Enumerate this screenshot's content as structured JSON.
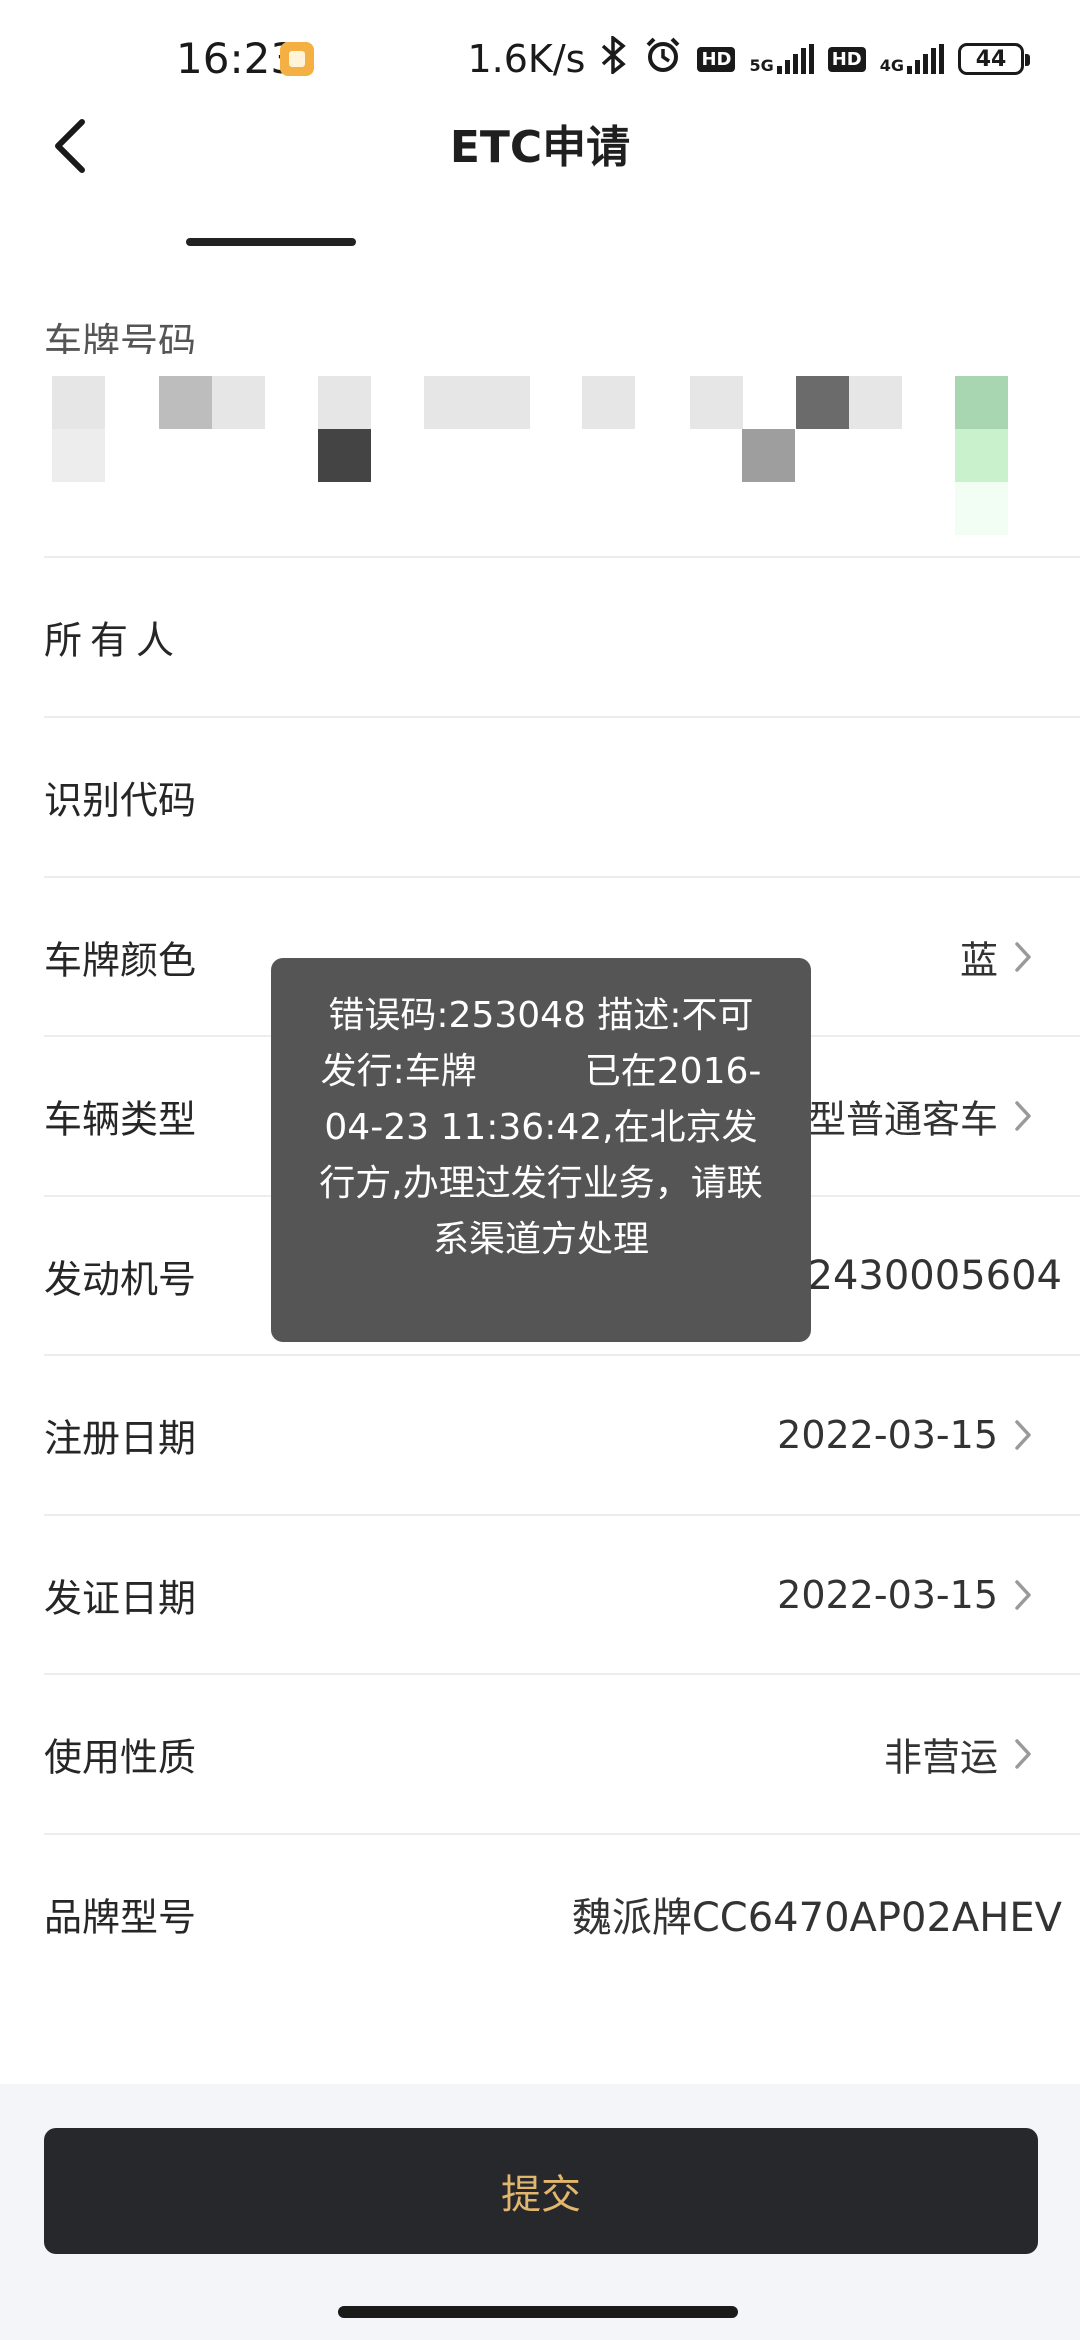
{
  "status_bar": {
    "time": "16:23",
    "net_speed": "1.6K/s",
    "hd_badge": "HD",
    "net_5g": "5G",
    "net_4g": "4G",
    "battery": "44"
  },
  "header": {
    "title": "ETC申请"
  },
  "form": {
    "plate_label": "车牌号码",
    "rows": [
      {
        "label": "所有人",
        "value": ""
      },
      {
        "label": "识别代码",
        "value": ""
      },
      {
        "label": "车牌颜色",
        "value": "蓝"
      },
      {
        "label": "车辆类型",
        "value": "型普通客车"
      },
      {
        "label": "发动机号",
        "value": "2430005604"
      },
      {
        "label": "注册日期",
        "value": "2022-03-15"
      },
      {
        "label": "发证日期",
        "value": "2022-03-15"
      },
      {
        "label": "使用性质",
        "value": "非营运"
      },
      {
        "label": "品牌型号",
        "value": "魏派牌CC6470AP02AHEV"
      }
    ]
  },
  "toast": {
    "message": "错误码:253048 描述:不可发行:车牌　　　已在2016-04-23 11:36:42,在北京发行方,办理过发行业务，请联系渠道方处理"
  },
  "submit": {
    "label": "提交"
  }
}
